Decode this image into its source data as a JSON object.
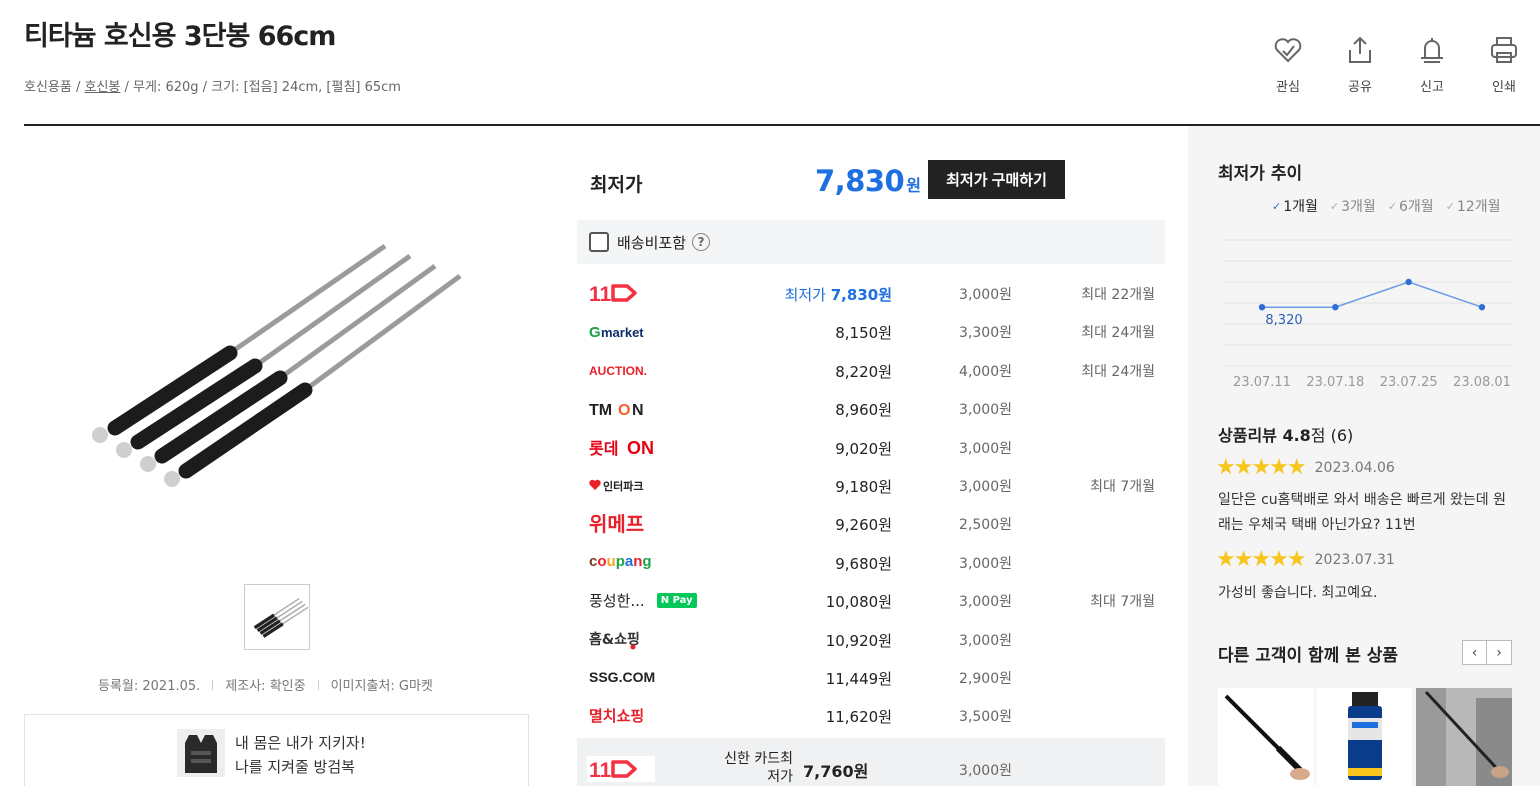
{
  "product": {
    "title": "티타늄 호신용 3단봉 66cm",
    "breadcrumb": {
      "cat1": "호신용품",
      "sep": " / ",
      "cat2": "호신봉",
      "specs": " / 무게: 620g / 크기: [접음] 24cm, [펼침] 65cm"
    }
  },
  "tools": [
    {
      "label": "관심",
      "icon": "heart-check-icon"
    },
    {
      "label": "공유",
      "icon": "share-icon"
    },
    {
      "label": "신고",
      "icon": "bell-icon"
    },
    {
      "label": "인쇄",
      "icon": "printer-icon"
    }
  ],
  "meta": {
    "registered": "등록월: 2021.05.",
    "maker": "제조사: 확인중",
    "image_source": "이미지출처: G마켓"
  },
  "ad": {
    "line1": "내 몸은 내가 지키자!",
    "line2": "나를 지켜줄 방검복"
  },
  "best": {
    "label": "최저가",
    "price": "7,830",
    "won": "원",
    "buy_label": "최저가 구매하기"
  },
  "shipping_option": {
    "label": "배송비포함",
    "help": "?"
  },
  "sellers": [
    {
      "store": "11번가",
      "price_tag": "최저가 ",
      "price": "7,830원",
      "ship": "3,000원",
      "installment": "최대 22개월",
      "best": true
    },
    {
      "store": "Gmarket",
      "price_tag": "",
      "price": "8,150원",
      "ship": "3,300원",
      "installment": "최대 24개월",
      "best": false
    },
    {
      "store": "AUCTION.",
      "price_tag": "",
      "price": "8,220원",
      "ship": "4,000원",
      "installment": "최대 24개월",
      "best": false
    },
    {
      "store": "TMON",
      "price_tag": "",
      "price": "8,960원",
      "ship": "3,000원",
      "installment": "",
      "best": false
    },
    {
      "store": "롯데ON",
      "price_tag": "",
      "price": "9,020원",
      "ship": "3,000원",
      "installment": "",
      "best": false
    },
    {
      "store": "인터파크",
      "price_tag": "",
      "price": "9,180원",
      "ship": "3,000원",
      "installment": "최대 7개월",
      "best": false
    },
    {
      "store": "위메프",
      "price_tag": "",
      "price": "9,260원",
      "ship": "2,500원",
      "installment": "",
      "best": false
    },
    {
      "store": "coupang",
      "price_tag": "",
      "price": "9,680원",
      "ship": "3,000원",
      "installment": "",
      "best": false
    },
    {
      "store": "풍성한...",
      "price_tag": "",
      "price": "10,080원",
      "ship": "3,000원",
      "installment": "최대 7개월",
      "best": false
    },
    {
      "store": "홈&쇼핑",
      "price_tag": "",
      "price": "10,920원",
      "ship": "3,000원",
      "installment": "",
      "best": false
    },
    {
      "store": "SSG.COM",
      "price_tag": "",
      "price": "11,449원",
      "ship": "2,900원",
      "installment": "",
      "best": false
    },
    {
      "store": "멸치쇼핑",
      "price_tag": "",
      "price": "11,620원",
      "ship": "3,500원",
      "installment": "",
      "best": false
    }
  ],
  "npay_badge": "N Pay",
  "card_best": {
    "store": "11번가",
    "label": "신한 카드최저가",
    "price": "7,760원",
    "ship": "3,000원"
  },
  "trend": {
    "title": "최저가 추이",
    "periods": [
      {
        "label": "1개월",
        "active": true
      },
      {
        "label": "3개월",
        "active": false
      },
      {
        "label": "6개월",
        "active": false
      },
      {
        "label": "12개월",
        "active": false
      }
    ]
  },
  "chart_data": {
    "type": "line",
    "x": [
      "23.07.11",
      "23.07.18",
      "23.07.25",
      "23.08.01"
    ],
    "series": [
      {
        "values": [
          8320,
          8320,
          8500,
          8320
        ]
      }
    ],
    "annotations": [
      {
        "x": "23.07.11",
        "label": "8,320"
      }
    ],
    "ylim": [
      7900,
      8800
    ],
    "grid": true
  },
  "reviews": {
    "title_prefix": "상품리뷰 ",
    "score": "4.8",
    "score_unit": "점",
    "count": " (6)",
    "items": [
      {
        "stars": "★★★★★",
        "date": "2023.04.06",
        "text": "일단은 cu홈택배로 와서 배송은 빠르게 왔는데 원래는 우체국 택배 아닌가요? 11번"
      },
      {
        "stars": "★★★★★",
        "date": "2023.07.31",
        "text": "가성비 좋습니다. 최고예요."
      }
    ]
  },
  "together": {
    "title": "다른 고객이 함께 본 상품",
    "prev": "‹",
    "next": "›"
  },
  "colors": {
    "accent_blue": "#1e6fe0",
    "star": "#f7c51c",
    "eleven_red": "#f43142",
    "npay_green": "#03c75a"
  }
}
